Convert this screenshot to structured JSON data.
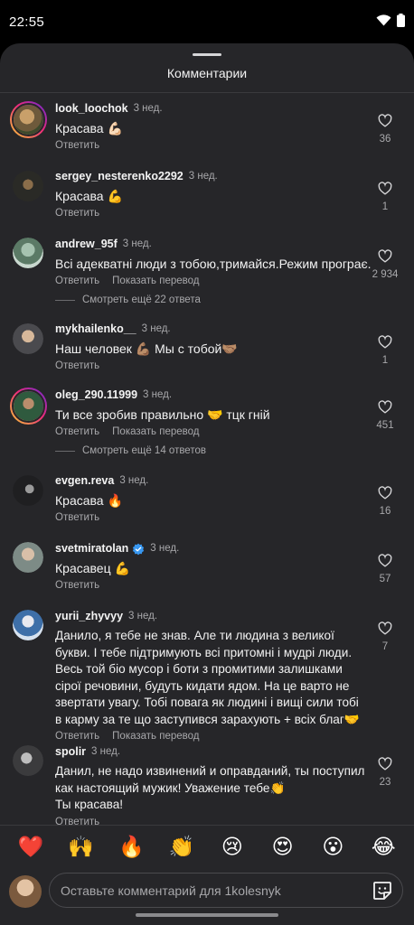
{
  "status_bar": {
    "time": "22:55"
  },
  "sheet": {
    "title": "Комментарии"
  },
  "comments": [
    {
      "user": "look_loochok",
      "time": "3 нед.",
      "text": "Красава 💪🏻",
      "actions": [
        "Ответить"
      ],
      "likes": "36"
    },
    {
      "user": "sergey_nesterenko2292",
      "time": "3 нед.",
      "text": "Красава 💪",
      "actions": [
        "Ответить"
      ],
      "likes": "1"
    },
    {
      "user": "andrew_95f",
      "time": "3 нед.",
      "text": "Всі адекватні люди з тобою,тримайся.Режим програє.",
      "actions": [
        "Ответить",
        "Показать перевод"
      ],
      "likes": "2 934",
      "more_replies": "Смотреть ещё 22 ответа"
    },
    {
      "user": "mykhailenko__",
      "time": "3 нед.",
      "text": "Наш человек 💪🏽 Мы с тобой🤝🏽",
      "actions": [
        "Ответить"
      ],
      "likes": "1"
    },
    {
      "user": "oleg_290.11999",
      "time": "3 нед.",
      "text": "Ти все зробив правильно 🤝 тцк гній",
      "actions": [
        "Ответить",
        "Показать перевод"
      ],
      "likes": "451",
      "more_replies": "Смотреть ещё 14 ответов"
    },
    {
      "user": "evgen.reva",
      "time": "3 нед.",
      "text": "Красава 🔥",
      "actions": [
        "Ответить"
      ],
      "likes": "16"
    },
    {
      "user": "svetmiratolan",
      "time": "3 нед.",
      "text": "Красавец 💪",
      "actions": [
        "Ответить"
      ],
      "likes": "57",
      "verified": true
    },
    {
      "user": "yurii_zhyvyy",
      "time": "3 нед.",
      "text": "Данило, я тебе не знав. Але ти людина з великої\nбукви. І тебе підтримують всі притомні і мудрі люди.\nВесь той біо мусор і боти з промитими залишками\nсірої речовини, будуть кидати ядом. На це варто не\nзвертати увагу. Тобі повага як людині і вищі сили тобі\nв карму за те що заступився зарахують + всіх благ🤝",
      "actions": [
        "Ответить",
        "Показать перевод"
      ],
      "likes": "7"
    },
    {
      "user": "spolir",
      "time": "3 нед.",
      "text": "Данил, не надо извинений и оправданий, ты поступил\nкак настоящий мужик! Уважение тебе👏\nТы красава!",
      "actions": [
        "Ответить"
      ],
      "likes": "23"
    }
  ],
  "emoji_bar": [
    "❤️",
    "🙌",
    "🔥",
    "👏",
    "😢",
    "😍",
    "😮",
    "😂"
  ],
  "composer": {
    "placeholder": "Оставьте комментарий для 1kolesnyk"
  },
  "icons": {
    "status": [
      "wifi-icon",
      "battery-icon"
    ],
    "like": "heart-outline-icon",
    "composer": "sticker-icon"
  },
  "colors": {
    "sheet_bg": "#262629",
    "secondary_text": "#a8a8ab",
    "verified": "#3897f0"
  }
}
